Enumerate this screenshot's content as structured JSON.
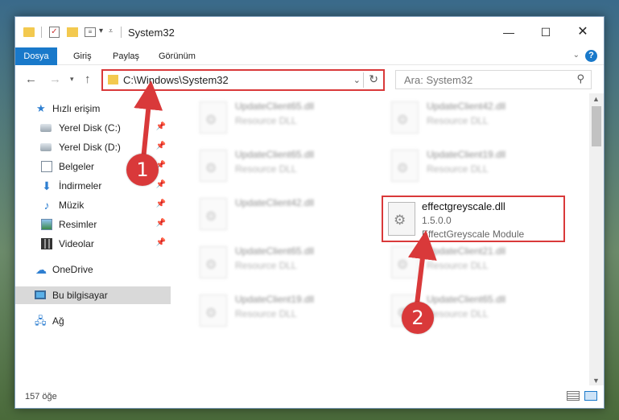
{
  "window": {
    "title": "System32",
    "controls": {
      "minimize": "—",
      "maximize": "☐",
      "close": "✕"
    }
  },
  "ribbon": {
    "tabs": [
      "Dosya",
      "Giriş",
      "Paylaş",
      "Görünüm"
    ],
    "help": "?"
  },
  "address": {
    "path": "C:\\Windows\\System32",
    "refresh_icon": "refresh-icon"
  },
  "search": {
    "placeholder": "Ara: System32"
  },
  "sidebar": {
    "items": [
      {
        "label": "Hızlı erişim",
        "icon": "star-icon",
        "pinned": false
      },
      {
        "label": "Yerel Disk (C:)",
        "icon": "disk-icon",
        "pinned": true
      },
      {
        "label": "Yerel Disk (D:)",
        "icon": "disk-icon",
        "pinned": true
      },
      {
        "label": "Belgeler",
        "icon": "documents-icon",
        "pinned": true
      },
      {
        "label": "İndirmeler",
        "icon": "downloads-icon",
        "pinned": true
      },
      {
        "label": "Müzik",
        "icon": "music-icon",
        "pinned": true
      },
      {
        "label": "Resimler",
        "icon": "pictures-icon",
        "pinned": true
      },
      {
        "label": "Videolar",
        "icon": "videos-icon",
        "pinned": true
      },
      {
        "label": "OneDrive",
        "icon": "cloud-icon",
        "pinned": false
      },
      {
        "label": "Bu bilgisayar",
        "icon": "pc-icon",
        "pinned": false,
        "selected": true
      },
      {
        "label": "Ağ",
        "icon": "network-icon",
        "pinned": false
      }
    ]
  },
  "files": [
    {
      "name": "UpdateClient65.dll",
      "desc": "Resource DLL"
    },
    {
      "name": "UpdateClient42.dll",
      "desc": "Resource DLL"
    },
    {
      "name": "UpdateClient65.dll",
      "desc": "Resource DLL"
    },
    {
      "name": "UpdateClient19.dll",
      "desc": "Resource DLL"
    },
    {
      "name": "UpdateClient42.dll",
      "desc": "Resource DLL"
    },
    {
      "name": "UpdateClient65.dll",
      "desc": "Resource DLL"
    },
    {
      "name": "UpdateClient21.dll",
      "desc": "Resource DLL"
    },
    {
      "name": "UpdateClient19.dll",
      "desc": "Resource DLL"
    },
    {
      "name": "UpdateClient65.dll",
      "desc": "Resource DLL"
    }
  ],
  "highlighted_file": {
    "name": "effectgreyscale.dll",
    "version": "1.5.0.0",
    "desc": "EffectGreyscale Module"
  },
  "status": {
    "count": "157 öğe"
  },
  "callouts": [
    "1",
    "2"
  ],
  "colors": {
    "accent": "#1979ca",
    "annotation": "#d9393a"
  }
}
